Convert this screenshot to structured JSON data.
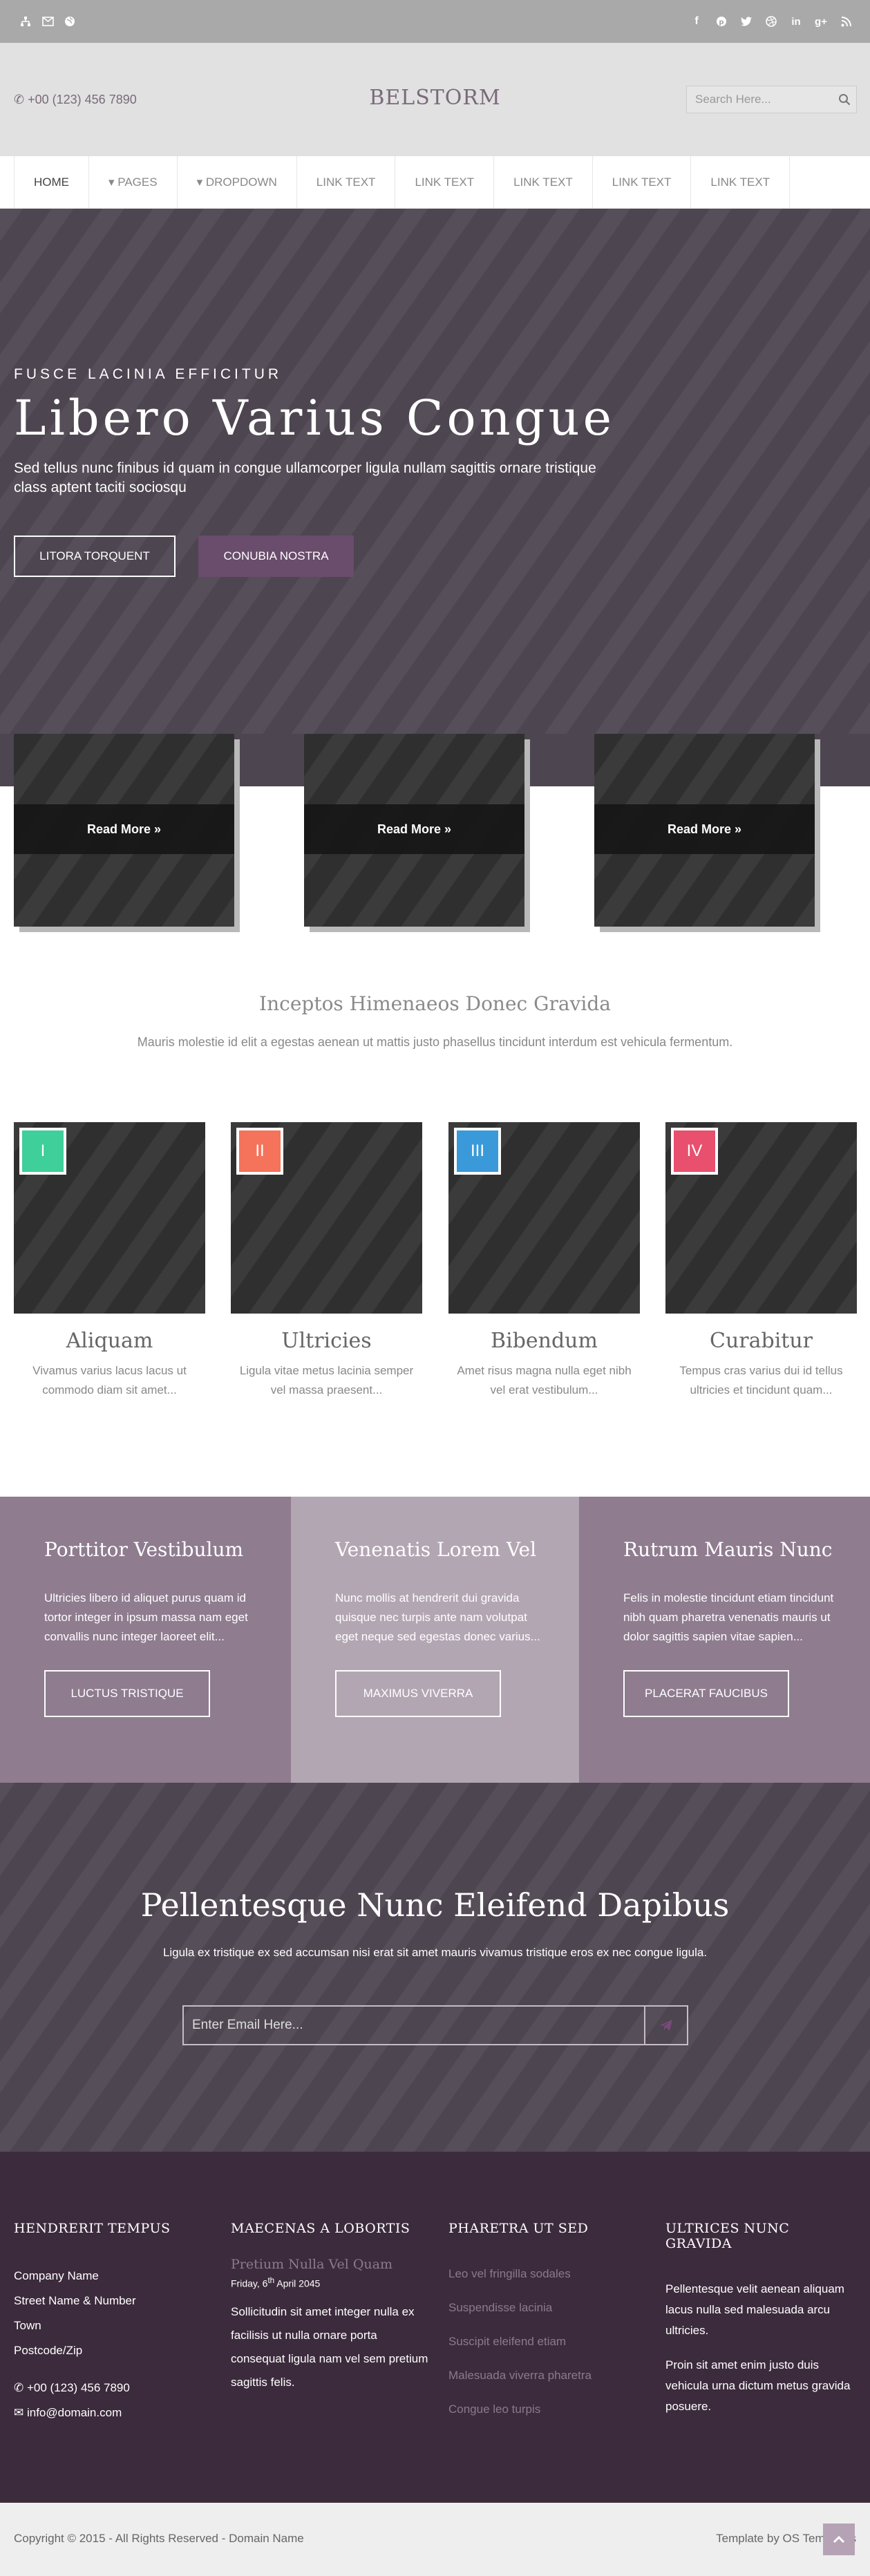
{
  "topbar": {
    "left_icons": [
      "sitemap-icon",
      "envelope-icon",
      "globe-icon"
    ],
    "social_icons": [
      "facebook-icon",
      "pinterest-icon",
      "twitter-icon",
      "dribbble-icon",
      "linkedin-icon",
      "google-plus-icon",
      "rss-icon"
    ]
  },
  "header": {
    "phone": "+00 (123) 456 7890",
    "brand": "BELSTORM",
    "search_placeholder": "Search Here..."
  },
  "nav": {
    "items": [
      {
        "label": "HOME"
      },
      {
        "label": "▾ PAGES"
      },
      {
        "label": "▾ DROPDOWN"
      },
      {
        "label": "LINK TEXT"
      },
      {
        "label": "LINK TEXT"
      },
      {
        "label": "LINK TEXT"
      },
      {
        "label": "LINK TEXT"
      },
      {
        "label": "LINK TEXT"
      }
    ]
  },
  "hero": {
    "eyebrow": "FUSCE LACINIA EFFICITUR",
    "title": "Libero Varius Congue",
    "subtitle": "Sed tellus nunc finibus id quam in congue ullamcorper ligula nullam sagittis ornare tristique class aptent taciti sociosqu",
    "button_primary": "LITORA TORQUENT",
    "button_secondary": "CONUBIA NOSTRA"
  },
  "promos": [
    {
      "label": "Read More »"
    },
    {
      "label": "Read More »"
    },
    {
      "label": "Read More »"
    }
  ],
  "intro": {
    "title": "Inceptos Himenaeos Donec Gravida",
    "text": "Mauris molestie id elit a egestas aenean ut mattis justo phasellus tincidunt interdum est vehicula fermentum."
  },
  "features": [
    {
      "badge": "I",
      "color": "#3ecf9a",
      "title": "Aliquam",
      "text": "Vivamus varius lacus lacus ut commodo diam sit amet..."
    },
    {
      "badge": "II",
      "color": "#f4735a",
      "title": "Ultricies",
      "text": "Ligula vitae metus lacinia semper vel massa praesent..."
    },
    {
      "badge": "III",
      "color": "#3a9ad9",
      "title": "Bibendum",
      "text": "Amet risus magna nulla eget nibh vel erat vestibulum..."
    },
    {
      "badge": "IV",
      "color": "#e8506e",
      "title": "Curabitur",
      "text": "Tempus cras varius dui id tellus ultricies et tincidunt quam..."
    }
  ],
  "columns": [
    {
      "title": "Porttitor Vestibulum",
      "text": "Ultricies libero id aliquet purus quam id tortor integer in ipsum massa nam eget convallis nunc integer laoreet elit...",
      "button": "LUCTUS TRISTIQUE",
      "color": "#8f7c8f"
    },
    {
      "title": "Venenatis Lorem Vel",
      "text": "Nunc mollis at hendrerit dui gravida quisque nec turpis ante nam volutpat eget neque sed egestas donec varius...",
      "button": "MAXIMUS VIVERRA",
      "color": "#b3a6b3"
    },
    {
      "title": "Rutrum Mauris Nunc",
      "text": "Felis in molestie tincidunt etiam tincidunt nibh quam pharetra venenatis mauris ut dolor sagittis sapien vitae sapien...",
      "button": "PLACERAT FAUCIBUS",
      "color": "#8f7c8f"
    }
  ],
  "newsletter": {
    "title": "Pellentesque Nunc Eleifend Dapibus",
    "text": "Ligula ex tristique ex sed accumsan nisi erat sit amet mauris vivamus tristique eros ex nec congue ligula.",
    "placeholder": "Enter Email Here..."
  },
  "footer": {
    "col1": {
      "heading": "HENDRERIT TEMPUS",
      "lines": [
        "Company Name",
        "Street Name & Number",
        "Town",
        "Postcode/Zip"
      ],
      "phone": "+00 (123) 456 7890",
      "email": "info@domain.com"
    },
    "col2": {
      "heading": "MAECENAS A LOBORTIS",
      "post_title": "Pretium Nulla Vel Quam",
      "post_date_prefix": "Friday, 6",
      "post_date_sup": "th",
      "post_date_suffix": " April 2045",
      "post_text": "Sollicitudin sit amet integer nulla ex facilisis ut nulla ornare porta consequat ligula nam vel sem pretium sagittis felis."
    },
    "col3": {
      "heading": "PHARETRA UT SED",
      "links": [
        "Leo vel fringilla sodales",
        "Suspendisse lacinia",
        "Suscipit eleifend etiam",
        "Malesuada viverra pharetra",
        "Congue leo turpis"
      ]
    },
    "col4": {
      "heading": "ULTRICES NUNC GRAVIDA",
      "para1": "Pellentesque velit aenean aliquam lacus nulla sed malesuada arcu ultricies.",
      "para2": "Proin sit amet enim justo duis vehicula urna dictum metus gravida posuere."
    }
  },
  "bottom": {
    "copyright": "Copyright © 2015 - All Rights Reserved - Domain Name",
    "credit": "Template by OS Templates"
  }
}
